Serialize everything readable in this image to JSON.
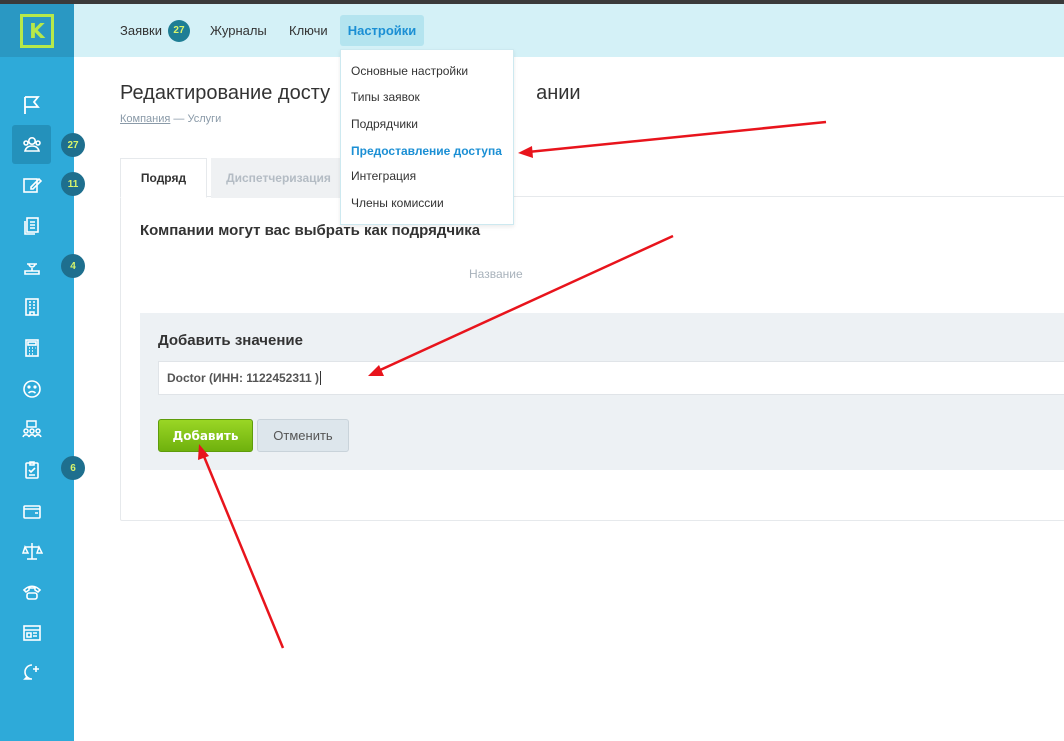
{
  "logo_letter": "K",
  "sidebar": {
    "items": [
      {
        "icon": "flag-icon",
        "badge": ""
      },
      {
        "icon": "users-icon",
        "badge": "27"
      },
      {
        "icon": "edit-icon",
        "badge": "11"
      },
      {
        "icon": "documents-icon",
        "badge": ""
      },
      {
        "icon": "inspector-icon",
        "badge": "4"
      },
      {
        "icon": "building-icon",
        "badge": ""
      },
      {
        "icon": "calculator-icon",
        "badge": ""
      },
      {
        "icon": "sad-face-icon",
        "badge": ""
      },
      {
        "icon": "team-icon",
        "badge": ""
      },
      {
        "icon": "clipboard-check-icon",
        "badge": "6"
      },
      {
        "icon": "wallet-icon",
        "badge": ""
      },
      {
        "icon": "scales-icon",
        "badge": ""
      },
      {
        "icon": "phone-icon",
        "badge": ""
      },
      {
        "icon": "browser-icon",
        "badge": ""
      },
      {
        "icon": "chat-add-icon",
        "badge": ""
      }
    ]
  },
  "topnav": {
    "requests": "Заявки",
    "requests_count": "27",
    "journals": "Журналы",
    "keys": "Ключи",
    "settings": "Настройки"
  },
  "dropdown": {
    "items": [
      "Основные настройки",
      "Типы заявок",
      "Подрядчики",
      "Предоставление доступа",
      "Интеграция",
      "Члены комиссии"
    ]
  },
  "page": {
    "title_left": "Редактирование досту",
    "title_right": "ании",
    "breadcrumb_link": "Компания",
    "breadcrumb_rest": " — Услуги"
  },
  "tabs": [
    "Подряд",
    "Диспетчеризация"
  ],
  "section": {
    "subheading": "Компании могут вас выбрать как подрядчика",
    "column_header": "Название"
  },
  "add_form": {
    "label": "Добавить значение",
    "value": "Doctor  (ИНН: 1122452311 )",
    "add_button": "Добавить",
    "cancel_button": "Отменить"
  },
  "colors": {
    "sidebar": "#2eaad9",
    "topbar": "#d4f1f7",
    "accent": "#1b8fd4",
    "add_button": "#7fc218",
    "badge": "#d9f56b",
    "arrow": "#e8141c"
  }
}
